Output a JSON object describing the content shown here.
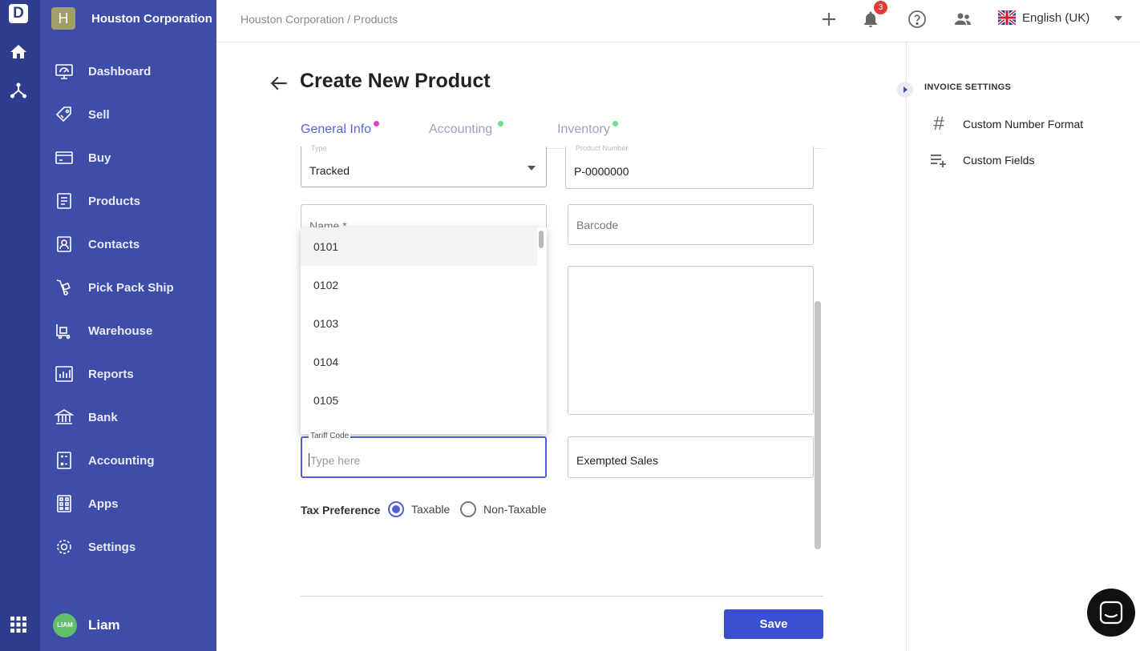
{
  "rail": {
    "logo": "D"
  },
  "sidebar": {
    "org_initial": "H",
    "org_name": "Houston Corporation",
    "items": [
      {
        "label": "Dashboard",
        "icon": "dashboard-icon"
      },
      {
        "label": "Sell",
        "icon": "sell-icon"
      },
      {
        "label": "Buy",
        "icon": "buy-icon"
      },
      {
        "label": "Products",
        "icon": "products-icon"
      },
      {
        "label": "Contacts",
        "icon": "contacts-icon"
      },
      {
        "label": "Pick Pack Ship",
        "icon": "pick-pack-ship-icon"
      },
      {
        "label": "Warehouse",
        "icon": "warehouse-icon"
      },
      {
        "label": "Reports",
        "icon": "reports-icon"
      },
      {
        "label": "Bank",
        "icon": "bank-icon"
      },
      {
        "label": "Accounting",
        "icon": "accounting-icon"
      },
      {
        "label": "Apps",
        "icon": "apps-icon"
      },
      {
        "label": "Settings",
        "icon": "settings-icon"
      }
    ],
    "user_initials": "LIAM",
    "user_name": "Liam"
  },
  "topbar": {
    "breadcrumb": "Houston Corporation / Products",
    "notification_count": "3",
    "language": "English (UK)"
  },
  "page": {
    "title": "Create New Product",
    "tabs": [
      {
        "label": "General Info",
        "dot_color": "#e040c8"
      },
      {
        "label": "Accounting",
        "dot_color": "#6ee08e"
      },
      {
        "label": "Inventory",
        "dot_color": "#6ee08e"
      }
    ]
  },
  "form": {
    "type_label": "Type",
    "type_value": "Tracked",
    "product_number_label": "Product Number",
    "product_number_value": "P-0000000",
    "name_placeholder": "Name *",
    "barcode_placeholder": "Barcode",
    "tariff_label": "Tariff Code",
    "tariff_placeholder": "Type here",
    "tax_code_value": "Exempted Sales",
    "tax_pref_label": "Tax Preference",
    "tax_options": [
      "Taxable",
      "Non-Taxable"
    ],
    "tax_selected": "Taxable",
    "save_label": "Save"
  },
  "dropdown": {
    "options": [
      "0101",
      "0102",
      "0103",
      "0104",
      "0105"
    ]
  },
  "right_panel": {
    "title": "INVOICE SETTINGS",
    "items": [
      {
        "label": "Custom Number Format",
        "icon": "hash-icon"
      },
      {
        "label": "Custom Fields",
        "icon": "playlist-add-icon"
      }
    ]
  },
  "colors": {
    "sidebar": "#3e4da8",
    "rail": "#2f3d8f",
    "accent": "#3b4fd1"
  }
}
